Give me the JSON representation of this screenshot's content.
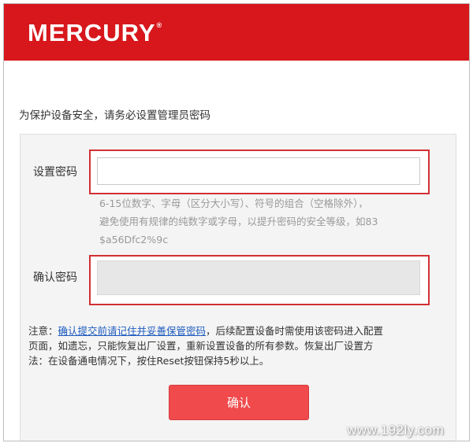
{
  "header": {
    "logo_text": "MERCURY",
    "logo_mark": "®",
    "background_color": "#d7171c"
  },
  "intro": "为保护设备安全，请务必设置管理员密码",
  "form": {
    "password_label": "设置密码",
    "password_value": "",
    "hint_lines": [
      "6-15位数字、字母（区分大小写）、符号的组合（空格除外），",
      "避免使用有规律的纯数字或字母，以提升密码的安全等级，如83",
      "$a56Dfc2%9c"
    ],
    "confirm_label": "确认密码",
    "confirm_value": "",
    "highlight_color": "#d23034"
  },
  "note": {
    "prefix": "注意：",
    "link": "确认提交前请记住并妥善保管密码",
    "line1_rest": "，后续配置设备时需使用该密码进入配置",
    "line2": "页面，如遗忘，只能恢复出厂设置，重新设置设备的所有参数。恢复出厂设置方",
    "line3": "法：在设备通电情况下，按住Reset按钮保持5秒以上。"
  },
  "confirm_button": {
    "label": "确认",
    "color": "#f04a4c"
  },
  "watermark": "www.192ly.com"
}
